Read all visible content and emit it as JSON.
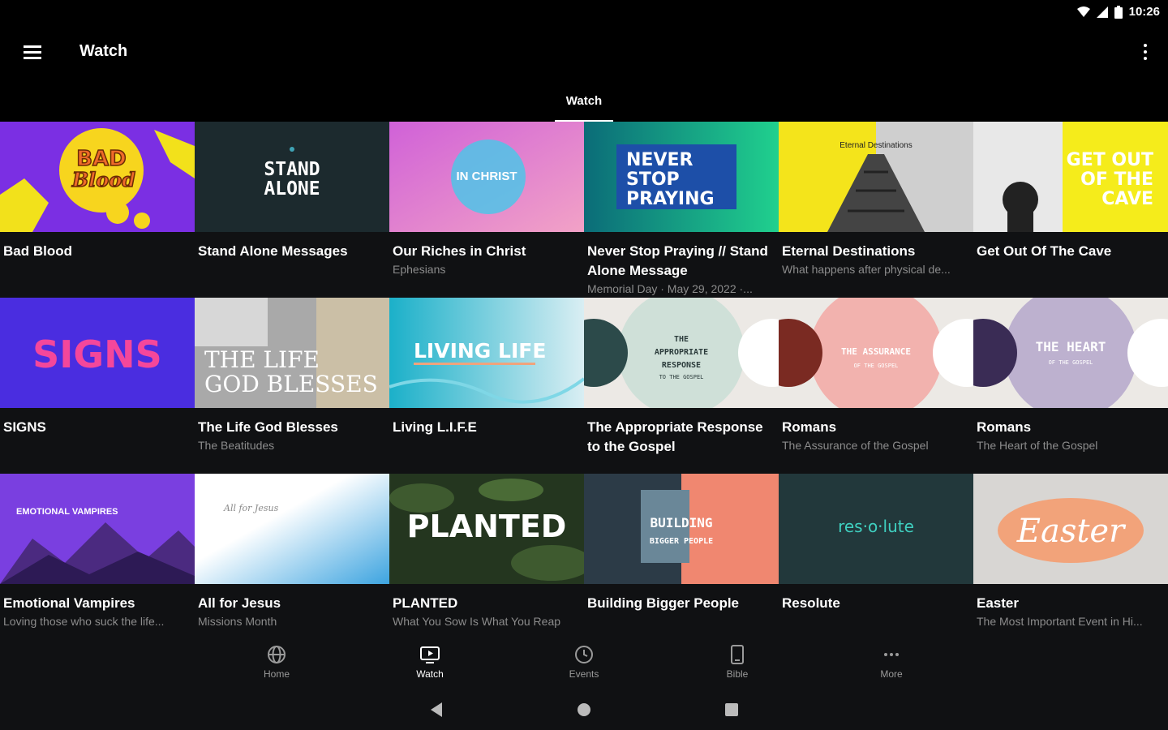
{
  "status": {
    "time": "10:26"
  },
  "app": {
    "title": "Watch"
  },
  "tabs": [
    {
      "label": "Watch"
    }
  ],
  "thumb_text": {
    "bad_blood_a": "BAD",
    "bad_blood_b": "Blood",
    "stand_alone_a": "STAND",
    "stand_alone_b": "ALONE",
    "in_christ": "IN CHRIST",
    "never_a": "NEVER",
    "never_b": "STOP",
    "never_c": "PRAYING",
    "eternal": "Eternal Destinations",
    "cave_a": "GET OUT",
    "cave_b": "OF THE",
    "cave_c": "CAVE",
    "signs": "SIGNS",
    "life_a": "THE LIFE",
    "life_b": "GOD BLESSES",
    "living": "LIVING LIFE",
    "approp_a": "THE",
    "approp_b": "APPROPRIATE",
    "approp_c": "RESPONSE",
    "approp_d": "TO THE GOSPEL",
    "assur_a": "THE ASSURANCE",
    "assur_b": "OF THE GOSPEL",
    "heart_a": "THE HEART",
    "heart_b": "OF THE GOSPEL",
    "emo": "EMOTIONAL VAMPIRES",
    "all_jesus": "All for Jesus",
    "planted": "PLANTED",
    "build_a": "BUILDING",
    "build_b": "BIGGER PEOPLE",
    "resolute": "res·o·lute",
    "easter": "Easter"
  },
  "cards": [
    {
      "title": "Bad Blood",
      "subtitle": ""
    },
    {
      "title": "Stand Alone Messages",
      "subtitle": ""
    },
    {
      "title": "Our Riches in Christ",
      "subtitle": "Ephesians"
    },
    {
      "title": "Never Stop Praying // Stand Alone Message",
      "subtitle": "Memorial Day · May 29, 2022 ·..."
    },
    {
      "title": "Eternal Destinations",
      "subtitle": "What happens after physical de..."
    },
    {
      "title": "Get Out Of The Cave",
      "subtitle": ""
    },
    {
      "title": "SIGNS",
      "subtitle": ""
    },
    {
      "title": "The Life God Blesses",
      "subtitle": "The Beatitudes"
    },
    {
      "title": "Living L.I.F.E",
      "subtitle": ""
    },
    {
      "title": "The Appropriate Response to the Gospel",
      "subtitle": ""
    },
    {
      "title": "Romans",
      "subtitle": "The Assurance of the Gospel"
    },
    {
      "title": "Romans",
      "subtitle": "The Heart of the Gospel"
    },
    {
      "title": "Emotional Vampires",
      "subtitle": "Loving those who suck the life..."
    },
    {
      "title": "All for Jesus",
      "subtitle": "Missions Month"
    },
    {
      "title": "PLANTED",
      "subtitle": "What You Sow Is What You Reap"
    },
    {
      "title": "Building Bigger People",
      "subtitle": ""
    },
    {
      "title": "Resolute",
      "subtitle": ""
    },
    {
      "title": "Easter",
      "subtitle": "The Most Important Event in Hi..."
    }
  ],
  "bottom_nav": [
    {
      "label": "Home",
      "icon": "globe-icon"
    },
    {
      "label": "Watch",
      "icon": "tv-icon"
    },
    {
      "label": "Events",
      "icon": "clock-icon"
    },
    {
      "label": "Bible",
      "icon": "tablet-icon"
    },
    {
      "label": "More",
      "icon": "more-dots-icon"
    }
  ],
  "colors": {
    "background": "#000000",
    "grid_bg": "#101113",
    "subtitle": "#8c8c8c"
  }
}
